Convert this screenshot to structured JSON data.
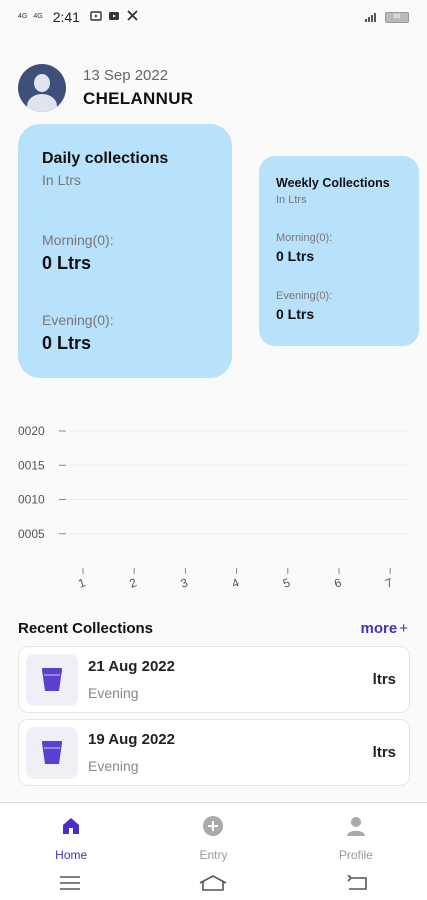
{
  "status_bar": {
    "net1": "4G",
    "net2": "4G",
    "time": "2:41",
    "battery": "88"
  },
  "header": {
    "date": "13 Sep 2022",
    "location": "CHELANNUR"
  },
  "daily_card": {
    "title": "Daily collections",
    "unit": "In Ltrs",
    "morning_label": "Morning(0):",
    "morning_value": "0 Ltrs",
    "evening_label": "Evening(0):",
    "evening_value": "0 Ltrs"
  },
  "weekly_card": {
    "title": "Weekly Collections",
    "unit": "In Ltrs",
    "morning_label": "Morning(0):",
    "morning_value": "0 Ltrs",
    "evening_label": "Evening(0):",
    "evening_value": "0 Ltrs"
  },
  "chart_data": {
    "type": "line",
    "x": [
      "1",
      "2",
      "3",
      "4",
      "5",
      "6",
      "7"
    ],
    "ytick_labels": [
      "0020",
      "0015",
      "0010",
      "0005"
    ],
    "yticks": [
      20,
      15,
      10,
      5
    ],
    "ylim": [
      0,
      20
    ],
    "series": [
      {
        "values": [
          0,
          0,
          0,
          0,
          0,
          0,
          0
        ]
      }
    ],
    "grid": true
  },
  "recent": {
    "title": "Recent Collections",
    "more_label": "more",
    "more_icon": "+",
    "items": [
      {
        "date": "21 Aug 2022",
        "session": "Evening",
        "unit": "ltrs",
        "icon": "milk-container-icon"
      },
      {
        "date": "19 Aug 2022",
        "session": "Evening",
        "unit": "ltrs",
        "icon": "milk-container-icon"
      }
    ]
  },
  "nav": {
    "items": [
      {
        "label": "Home",
        "icon": "home-icon"
      },
      {
        "label": "Entry",
        "icon": "add-circle-icon"
      },
      {
        "label": "Profile",
        "icon": "person-icon"
      }
    ]
  },
  "colors": {
    "accent": "#4b2fc4",
    "card_bg": "#b8e1fb",
    "icon_purple": "#5b3fd0",
    "nav_inactive": "#aaaaaa"
  }
}
